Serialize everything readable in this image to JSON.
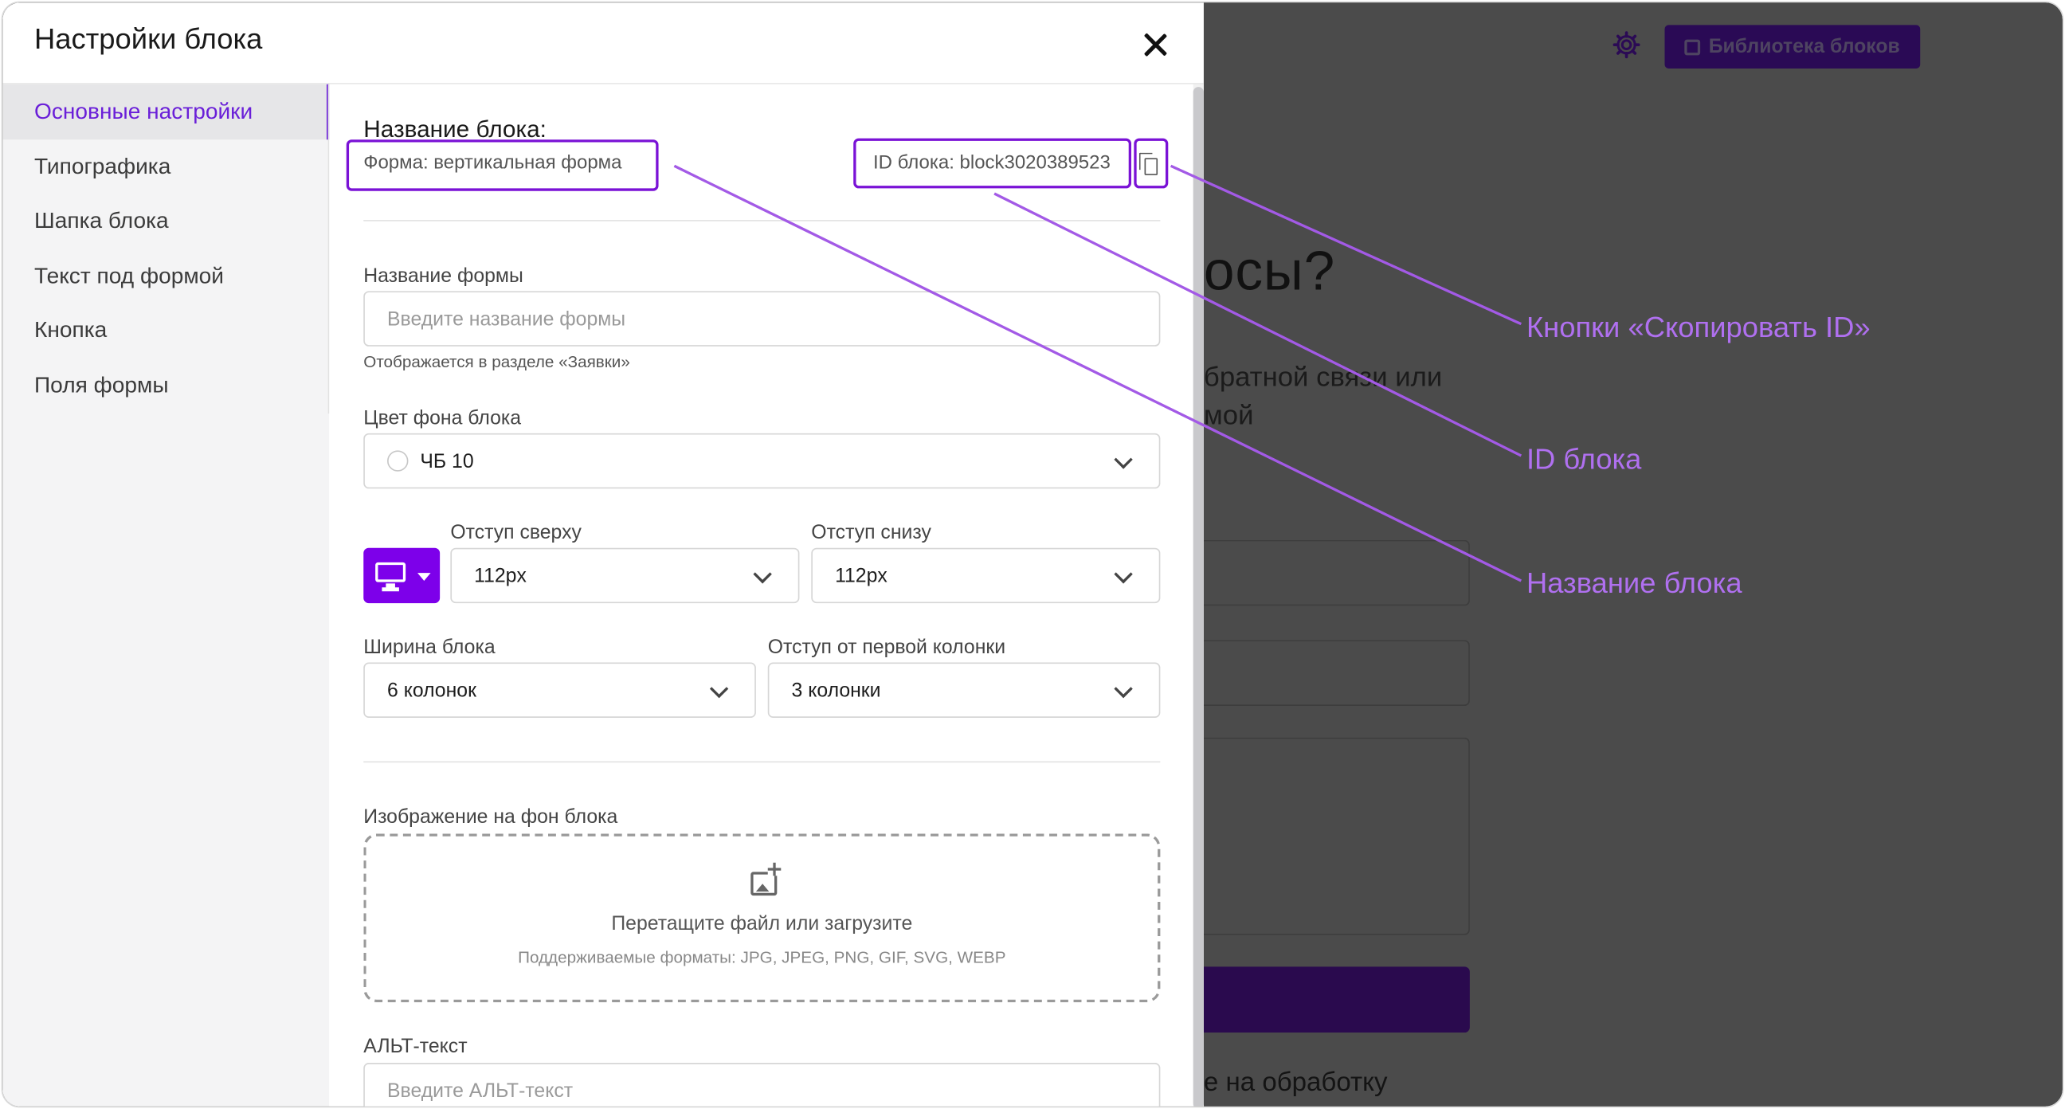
{
  "modal": {
    "title": "Настройки блока"
  },
  "sidebar": {
    "items": [
      {
        "label": "Основные настройки",
        "active": true
      },
      {
        "label": "Типографика"
      },
      {
        "label": "Шапка блока"
      },
      {
        "label": "Текст под формой"
      },
      {
        "label": "Кнопка"
      },
      {
        "label": "Поля формы"
      }
    ]
  },
  "block": {
    "title": "Название блока:",
    "name": "Форма: вертикальная форма",
    "id": "ID блока: block3020389523"
  },
  "form_name": {
    "label": "Название формы",
    "placeholder": "Введите название формы",
    "hint": "Отображается в разделе «Заявки»"
  },
  "bg_color": {
    "label": "Цвет фона блока",
    "value": "ЧБ 10"
  },
  "padding": {
    "top_label": "Отступ сверху",
    "top_value": "112px",
    "bottom_label": "Отступ снизу",
    "bottom_value": "112px"
  },
  "width": {
    "label": "Ширина блока",
    "value": "6 колонок"
  },
  "offset": {
    "label": "Отступ от первой колонки",
    "value": "3 колонки"
  },
  "bg_image": {
    "label": "Изображение на фон блока",
    "drop_text": "Перетащите файл или загрузите",
    "formats": "Поддерживаемые форматы: JPG, JPEG, PNG, GIF, SVG, WEBP"
  },
  "alt_text": {
    "label": "АЛЬТ-текст",
    "placeholder": "Введите АЛЬТ-текст"
  },
  "background_page": {
    "library_button": "Библиотека блоков",
    "heading_fragment": "осы?",
    "text_line1": "братной связи или",
    "text_line2": "мой",
    "footer_fragment": "е на обработку"
  },
  "annotations": {
    "copy_id": "Кнопки «Скопировать ID»",
    "block_id": "ID блока",
    "block_name": "Название блока"
  },
  "colors": {
    "accent": "#7d00ea",
    "annotation": "#b070f0",
    "annotation_box": "#7a12d6",
    "overlay": "#4b4b4b"
  }
}
